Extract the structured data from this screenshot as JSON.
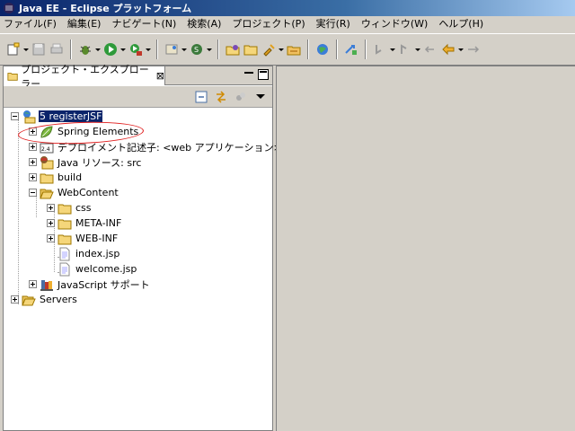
{
  "window": {
    "title": "Java EE - Eclipse プラットフォーム"
  },
  "menu": [
    "ファイル(F)",
    "編集(E)",
    "ナビゲート(N)",
    "検索(A)",
    "プロジェクト(P)",
    "実行(R)",
    "ウィンドウ(W)",
    "ヘルプ(H)"
  ],
  "view": {
    "tab_label": "プロジェクト・エクスプローラー",
    "close_glyph": "⊠"
  },
  "tree": {
    "project": "registerJSF",
    "project_prefix": "5",
    "items": [
      {
        "label": "Spring Elements"
      },
      {
        "label": "デプロイメント記述子: <web アプリケーション>"
      },
      {
        "label": "Java リソース: src"
      },
      {
        "label": "build"
      },
      {
        "label": "WebContent"
      },
      {
        "label": "css"
      },
      {
        "label": "META-INF"
      },
      {
        "label": "WEB-INF"
      },
      {
        "label": "index.jsp"
      },
      {
        "label": "welcome.jsp"
      },
      {
        "label": "JavaScript サポート"
      },
      {
        "label": "Servers"
      }
    ]
  },
  "colors": {
    "selection": "#0a246a",
    "annotation": "#e02020",
    "folder": "#f5d67a"
  }
}
